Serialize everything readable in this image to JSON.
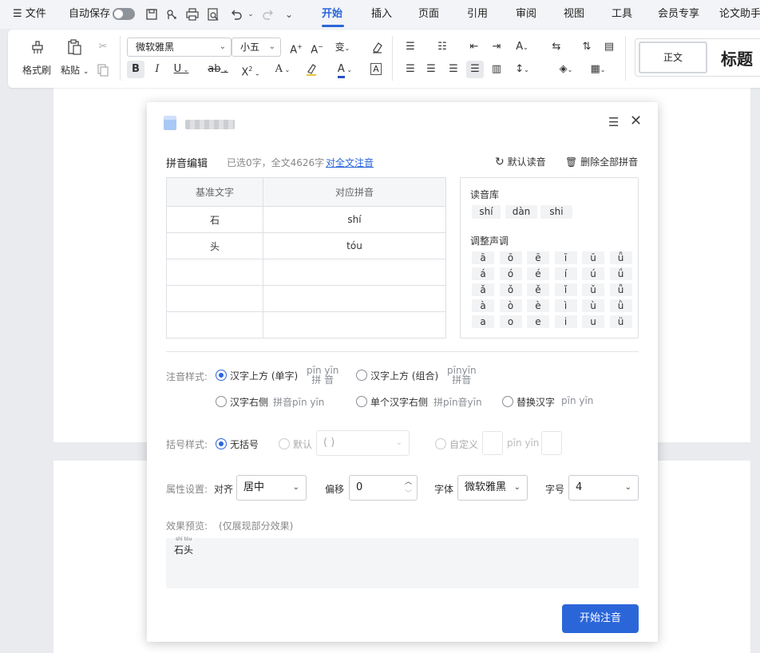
{
  "menubar": {
    "file_label": "文件",
    "autosave_label": "自动保存",
    "tabs": [
      "开始",
      "插入",
      "页面",
      "引用",
      "审阅",
      "视图",
      "工具",
      "会员专享",
      "论文助手"
    ]
  },
  "ribbon": {
    "format_painter": "格式刷",
    "paste": "粘贴",
    "font_family": "微软雅黑",
    "font_size": "小五",
    "style_body": "正文",
    "style_heading": "标题"
  },
  "dialog": {
    "title": "",
    "section_label": "拼音编辑",
    "selection_info": "已选0字，全文4626字",
    "annotate_all_link": "对全文注音",
    "default_reading_btn": "默认读音",
    "delete_all_btn": "删除全部拼音",
    "table": {
      "headers": [
        "基准文字",
        "对应拼音"
      ],
      "rows": [
        {
          "base": "石",
          "pinyin": "shí"
        },
        {
          "base": "头",
          "pinyin": "tóu"
        },
        {
          "base": "",
          "pinyin": ""
        },
        {
          "base": "",
          "pinyin": ""
        },
        {
          "base": "",
          "pinyin": ""
        }
      ]
    },
    "library": {
      "title": "读音库",
      "readings": [
        "shí",
        "dàn",
        "shi"
      ],
      "tone_title": "调整声调",
      "tones": [
        [
          "ā",
          "ō",
          "ē",
          "ī",
          "ū",
          "ǖ"
        ],
        [
          "á",
          "ó",
          "é",
          "í",
          "ú",
          "ǘ"
        ],
        [
          "ǎ",
          "ǒ",
          "ě",
          "ǐ",
          "ǔ",
          "ǚ"
        ],
        [
          "à",
          "ò",
          "è",
          "ì",
          "ù",
          "ǜ"
        ],
        [
          "a",
          "o",
          "e",
          "i",
          "u",
          "ü"
        ]
      ]
    },
    "annotation_style": {
      "label": "注音样式:",
      "options": [
        {
          "label": "汉字上方 (单字)",
          "ex_top": "pīn yīn",
          "ex_bottom": "拼 音",
          "selected": true
        },
        {
          "label": "汉字上方 (组合)",
          "ex_top": "pīnyīn",
          "ex_bottom": "拼音",
          "selected": false
        },
        {
          "label": "汉字右侧",
          "example": "拼音pīn yīn",
          "selected": false
        },
        {
          "label": "单个汉字右侧",
          "example": "拼pīn音yīn",
          "selected": false
        },
        {
          "label": "替换汉字",
          "example": "pīn yīn",
          "selected": false
        }
      ]
    },
    "bracket_style": {
      "label": "括号样式:",
      "none": "无括号",
      "default": "默认",
      "default_value": "( )",
      "custom": "自定义",
      "custom_example": "pīn yīn"
    },
    "properties": {
      "label": "属性设置:",
      "align_label": "对齐",
      "align_value": "居中",
      "offset_label": "偏移",
      "offset_value": "0",
      "font_label": "字体",
      "font_value": "微软雅黑",
      "size_label": "字号",
      "size_value": "4"
    },
    "preview": {
      "label": "效果预览:",
      "note": "(仅展现部分效果)",
      "ruby": "shí tóu",
      "text": "石头"
    },
    "start_button": "开始注音"
  }
}
